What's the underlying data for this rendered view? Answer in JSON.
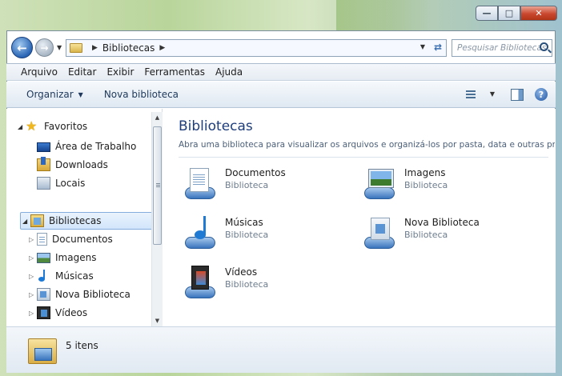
{
  "window": {
    "minimize_icon": "minimize-icon",
    "maximize_icon": "maximize-icon",
    "close_icon": "close-icon"
  },
  "address": {
    "breadcrumb": "Bibliotecas",
    "search_placeholder": "Pesquisar Bibliotecas"
  },
  "menu": [
    "Arquivo",
    "Editar",
    "Exibir",
    "Ferramentas",
    "Ajuda"
  ],
  "toolbar": {
    "organize": "Organizar",
    "new_library": "Nova biblioteca"
  },
  "navigation": {
    "favorites": {
      "label": "Favoritos",
      "items": [
        "Área de Trabalho",
        "Downloads",
        "Locais"
      ]
    },
    "libraries": {
      "label": "Bibliotecas",
      "items": [
        "Documentos",
        "Imagens",
        "Músicas",
        "Nova Biblioteca",
        "Vídeos"
      ]
    }
  },
  "content": {
    "title": "Bibliotecas",
    "description": "Abra uma biblioteca para visualizar os arquivos e organizá-los por pasta, data e outras propr...",
    "items": [
      {
        "name": "Documentos",
        "type": "Biblioteca"
      },
      {
        "name": "Imagens",
        "type": "Biblioteca"
      },
      {
        "name": "Músicas",
        "type": "Biblioteca"
      },
      {
        "name": "Nova Biblioteca",
        "type": "Biblioteca"
      },
      {
        "name": "Vídeos",
        "type": "Biblioteca"
      }
    ]
  },
  "details": {
    "count": "5 itens"
  },
  "colors": {
    "title_blue": "#1e3d7b",
    "selection": "#d2e5fb",
    "close_red": "#c9472e"
  }
}
